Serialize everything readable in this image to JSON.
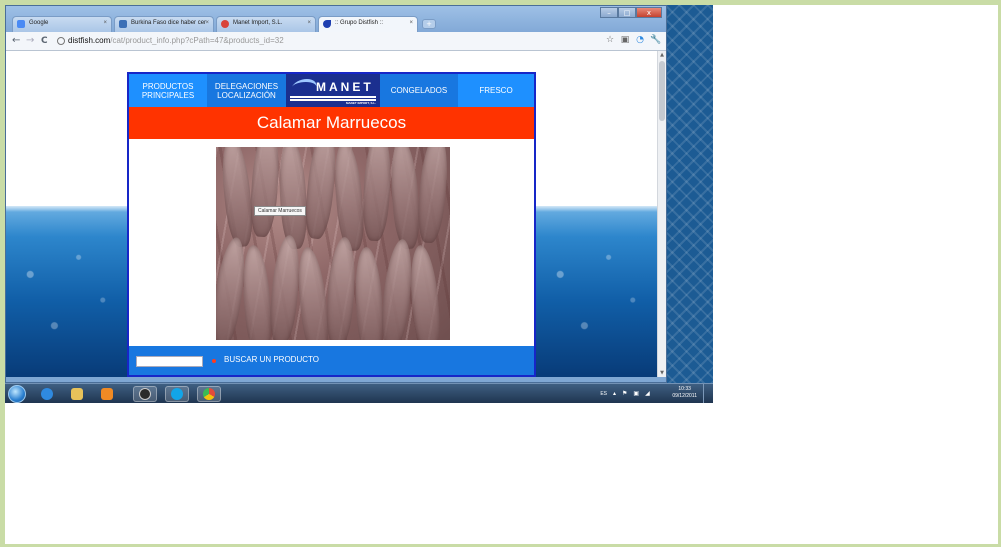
{
  "browser": {
    "tabs": [
      {
        "label": "Google",
        "favicon_color": "#4a8af4",
        "active": false
      },
      {
        "label": "Burkina Faso dice haber cer",
        "favicon_color": "#3b6fb6",
        "active": false
      },
      {
        "label": "Manet Import, S.L.",
        "favicon_color": "#d9443a",
        "active": false
      },
      {
        "label": ":: Grupo Distfish ::",
        "favicon_color": "#1e3fb0",
        "active": true
      }
    ],
    "new_tab_label": "+",
    "window_controls": {
      "minimize": "–",
      "maximize": "□",
      "close": "x"
    },
    "nav": {
      "back": "←",
      "forward": "→",
      "reload": "C"
    },
    "url_domain": "distfish.com",
    "url_path": "/cat/product_info.php?cPath=47&products_id=32",
    "toolbar_icons": {
      "star": "☆",
      "page": "▣",
      "extension": "◔",
      "wrench": "🔧"
    }
  },
  "site": {
    "nav": {
      "productos": "PRODUCTOS PRINCIPALES",
      "delegaciones": "DELEGACIONES LOCALIZACIÓN",
      "congelados": "CONGELADOS",
      "fresco": "FRESCO"
    },
    "logo": {
      "word": "MANET",
      "sub": "MANET IMPORT, S.L."
    },
    "product_title": "Calamar Marruecos",
    "image_tooltip": "Calamar Marruecos",
    "search": {
      "label": "BUSCAR UN PRODUCTO",
      "value": ""
    },
    "colors": {
      "nav_blue": "#1e90ff",
      "nav_dark": "#1877e0",
      "logo_navy": "#1b2f8f",
      "title_red": "#ff3300",
      "border_blue": "#1726c7"
    }
  },
  "taskbar": {
    "apps": [
      {
        "name": "ie-icon",
        "color": "#2f8ae0"
      },
      {
        "name": "explorer-icon",
        "color": "#e7c25a"
      },
      {
        "name": "media-player-icon",
        "color": "#f08a24"
      },
      {
        "name": "hp-icon",
        "color": "#2b2b2b"
      },
      {
        "name": "skype-icon",
        "color": "#12a5e8"
      },
      {
        "name": "chrome-icon",
        "color": "#e34b3a"
      }
    ],
    "language": "ES",
    "time": "10:33",
    "date": "09/12/2011"
  }
}
